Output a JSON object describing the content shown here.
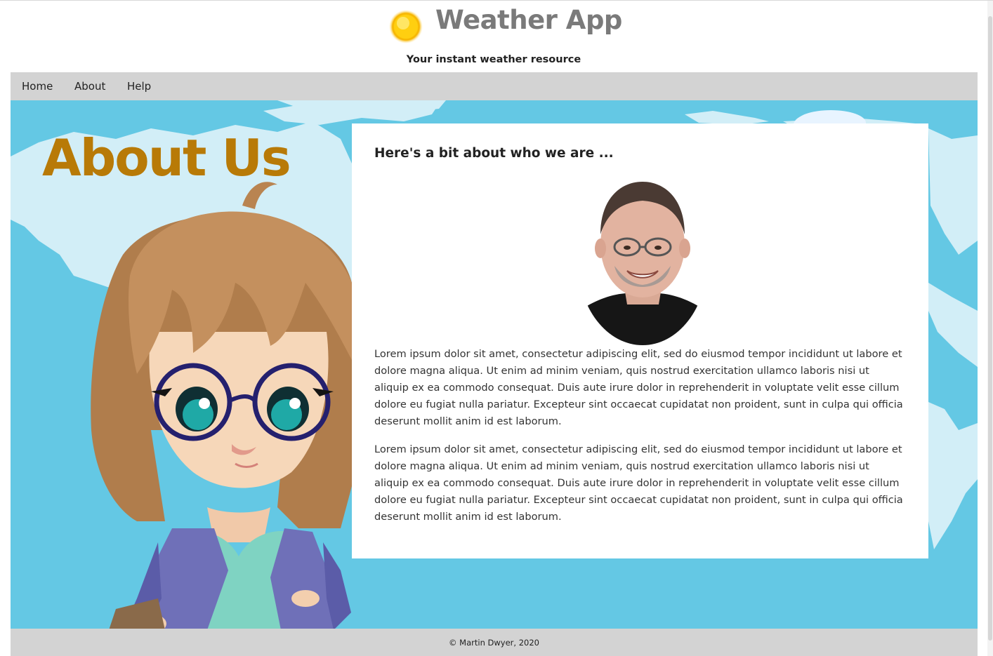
{
  "header": {
    "app_title": "Weather App",
    "tagline": "Your instant weather resource",
    "logo_icon": "sun-icon"
  },
  "nav": {
    "items": [
      {
        "label": "Home"
      },
      {
        "label": "About"
      },
      {
        "label": "Help"
      }
    ]
  },
  "main": {
    "page_heading": "About Us",
    "card": {
      "heading": "Here's a bit about who we are ...",
      "paragraphs": [
        "Lorem ipsum dolor sit amet, consectetur adipiscing elit, sed do eiusmod tempor incididunt ut labore et dolore magna aliqua. Ut enim ad minim veniam, quis nostrud exercitation ullamco laboris nisi ut aliquip ex ea commodo consequat. Duis aute irure dolor in reprehenderit in voluptate velit esse cillum dolore eu fugiat nulla pariatur. Excepteur sint occaecat cupidatat non proident, sunt in culpa qui officia deserunt mollit anim id est laborum.",
        "Lorem ipsum dolor sit amet, consectetur adipiscing elit, sed do eiusmod tempor incididunt ut labore et dolore magna aliqua. Ut enim ad minim veniam, quis nostrud exercitation ullamco laboris nisi ut aliquip ex ea commodo consequat. Duis aute irure dolor in reprehenderit in voluptate velit esse cillum dolore eu fugiat nulla pariatur. Excepteur sint occaecat cupidatat non proident, sunt in culpa qui officia deserunt mollit anim id est laborum."
      ]
    }
  },
  "footer": {
    "text": "© Martin Dwyer, 2020"
  },
  "colors": {
    "heading_gold": "#b87a07",
    "sky_blue": "#64c8e4",
    "bar_gray": "#d3d3d3",
    "title_gray": "#7a7a7a"
  }
}
